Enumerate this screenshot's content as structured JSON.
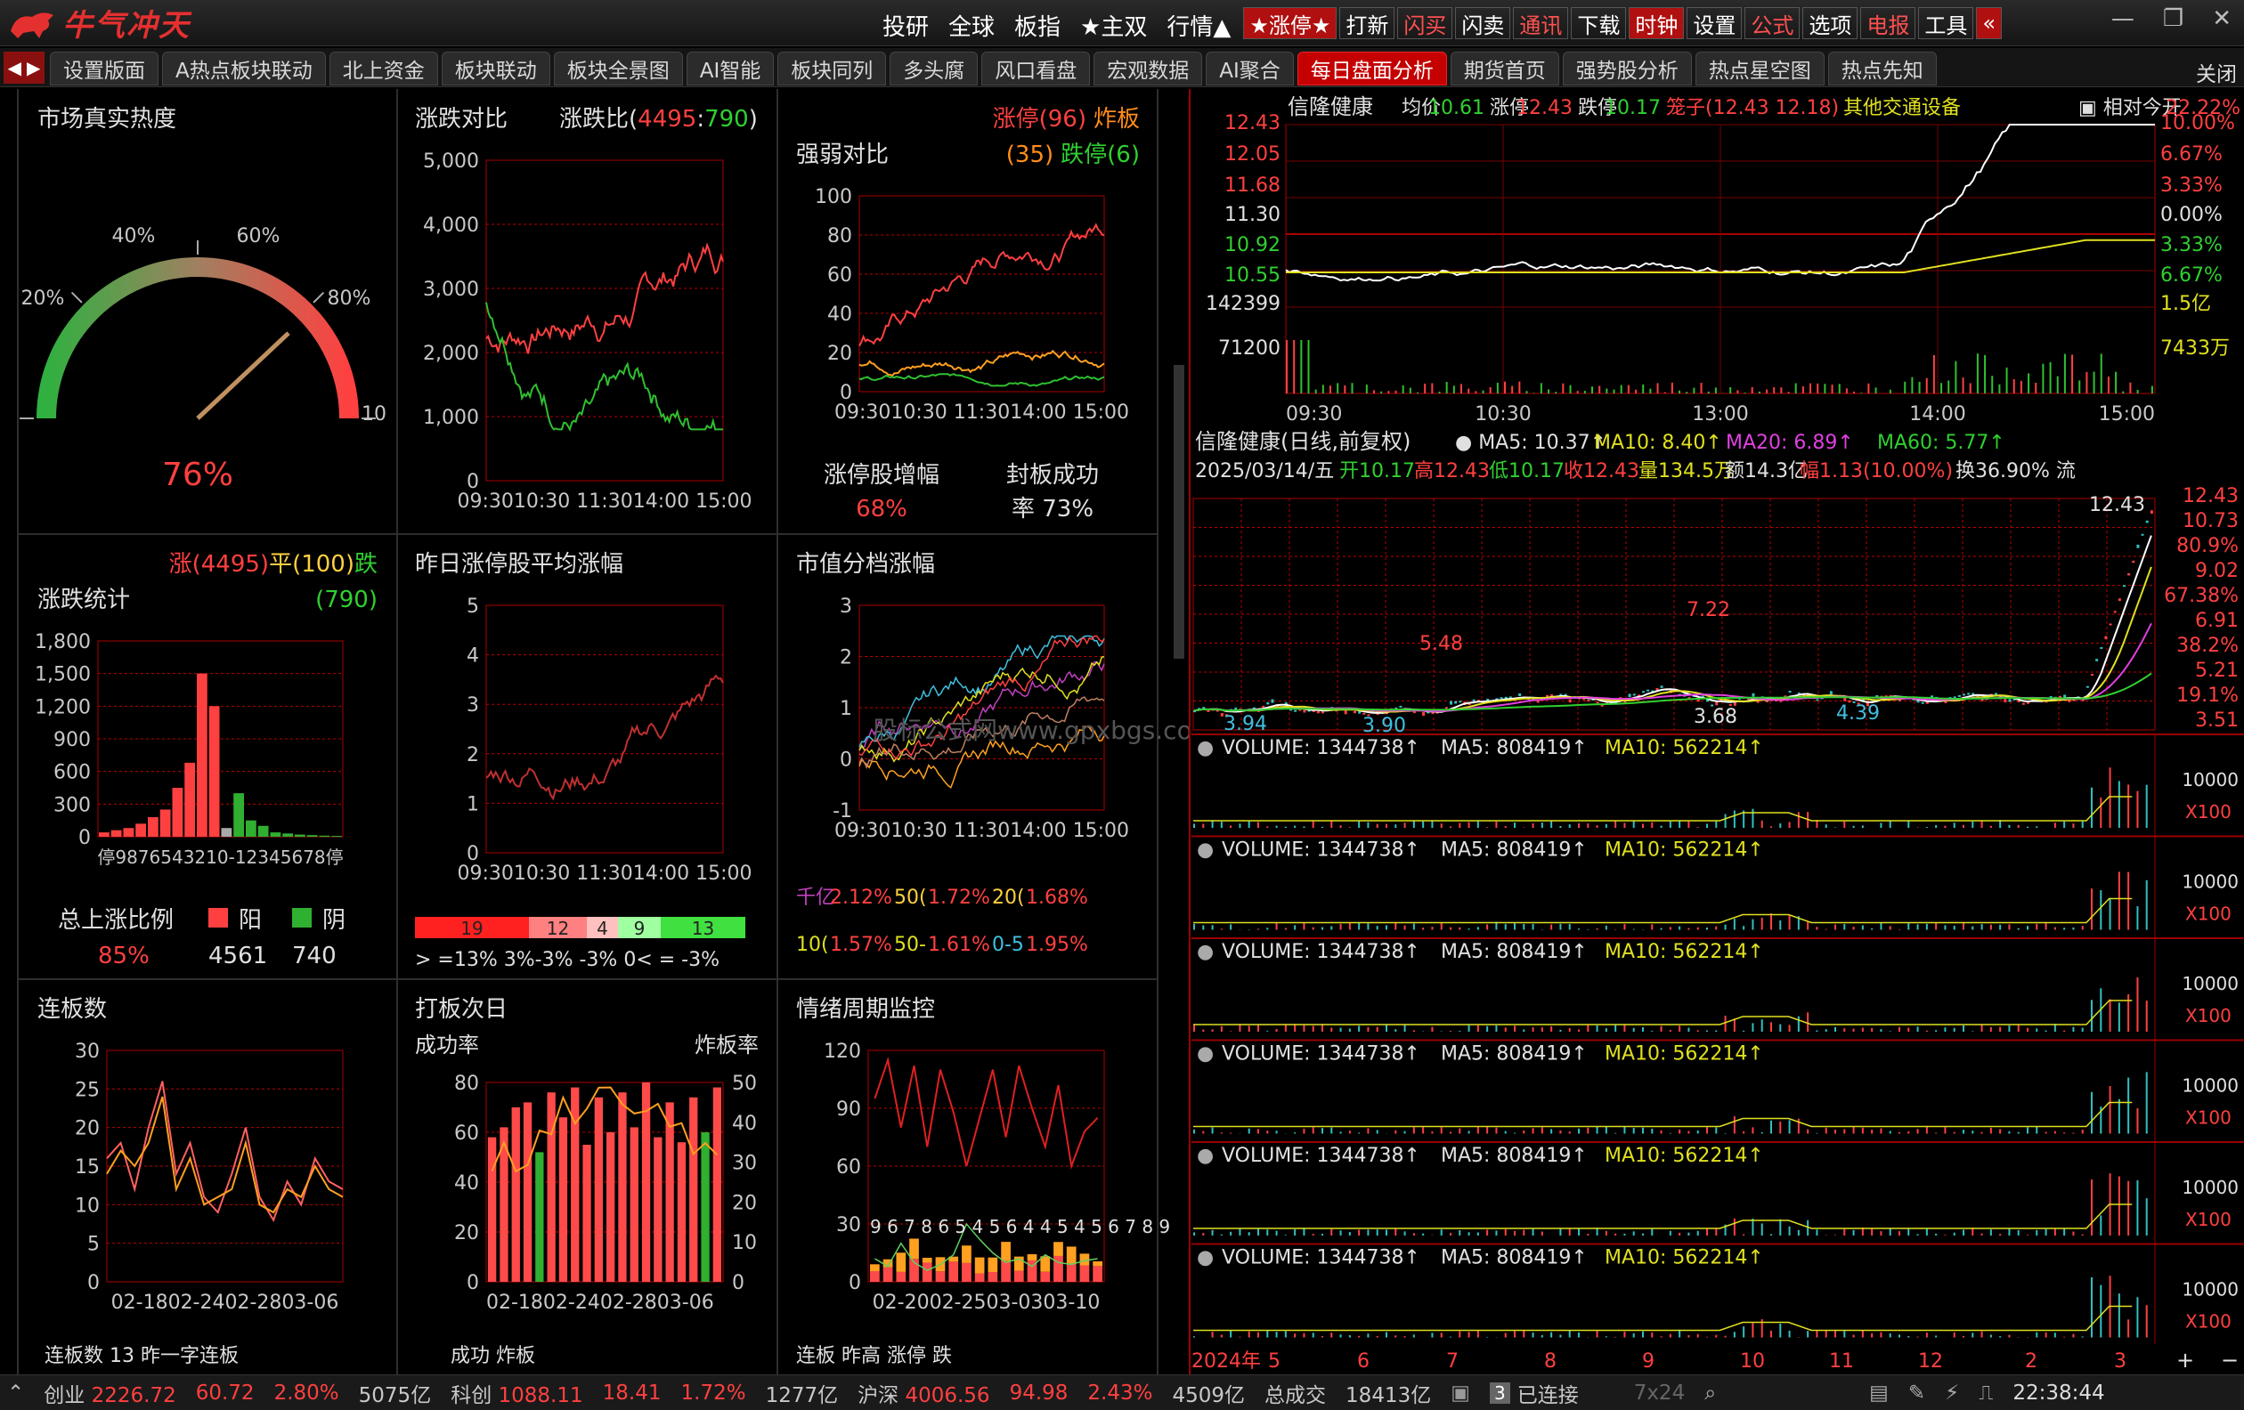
{
  "app": {
    "logo": "牛气冲天"
  },
  "menu": [
    "投研",
    "全球",
    "板指",
    "★主双",
    "行情▲"
  ],
  "toolbar": [
    {
      "label": "★涨停★",
      "style": "redbg"
    },
    {
      "label": "打新"
    },
    {
      "label": "闪买",
      "style": "red"
    },
    {
      "label": "闪卖"
    },
    {
      "label": "通讯",
      "style": "red"
    },
    {
      "label": "下载"
    },
    {
      "label": "时钟",
      "style": "redbg"
    },
    {
      "label": "设置"
    },
    {
      "label": "公式",
      "style": "red"
    },
    {
      "label": "选项"
    },
    {
      "label": "电报",
      "style": "red"
    },
    {
      "label": "工具"
    },
    {
      "label": "«",
      "style": "redbg"
    }
  ],
  "tabs": [
    "设置版面",
    "A热点板块联动",
    "北上资金",
    "板块联动",
    "板块全景图",
    "AI智能",
    "板块同列",
    "多头腐",
    "风口看盘",
    "宏观数据",
    "AI聚合",
    "每日盘面分析",
    "期货首页",
    "强势股分析",
    "热点星空图",
    "热点先知"
  ],
  "active_tab": "每日盘面分析",
  "close_label": "关闭",
  "heat": {
    "title": "市场真实热度",
    "value": "76%",
    "value_num": 76,
    "ticks": [
      "20%",
      "40%",
      "60%",
      "80%",
      "10"
    ]
  },
  "updown": {
    "title": "涨跌对比",
    "ratio_label": "涨跌比(",
    "up": "4495",
    "sep": ":",
    "down": "790",
    "close": ")",
    "y_ticks": [
      "5,000",
      "4,000",
      "3,000",
      "2,000",
      "1,000",
      "0"
    ],
    "x_ticks": "09:3010:30 11:3014:00 15:00"
  },
  "strength": {
    "head1_a": "涨停(96)",
    "head1_b": "炸板",
    "head2_a": "(35)",
    "head2_b": "跌停(6)",
    "title": "强弱对比",
    "y_ticks": [
      "100",
      "80",
      "60",
      "40",
      "20",
      "0"
    ],
    "x_ticks": "09:3010:30 11:3014:00 15:00",
    "lim_label": "涨停股增幅",
    "lim_val": "68%",
    "seal_label": "封板成功",
    "seal_val": "率 73%"
  },
  "stats": {
    "head_up": "涨(4495)",
    "head_flat": "平(100)",
    "head_down": "跌",
    "head_down_n": "(790)",
    "title": "涨跌统计",
    "y_ticks": [
      "1,800",
      "1,500",
      "1,200",
      "900",
      "600",
      "300",
      "0"
    ],
    "x_label": "停9876543210-12345678停",
    "bars": [
      40,
      60,
      80,
      120,
      180,
      250,
      450,
      680,
      1500,
      1200,
      80,
      400,
      150,
      100,
      40,
      30,
      20,
      15,
      10,
      8
    ],
    "ratio_label": "总上涨比例",
    "yang": "阳",
    "yin": "阴",
    "ratio": "85%",
    "yang_n": "4561",
    "yin_n": "740"
  },
  "yday": {
    "title": "昨日涨停股平均涨幅",
    "y_ticks": [
      "5",
      "4",
      "3",
      "2",
      "1",
      "0"
    ],
    "x_ticks": "09:3010:30 11:3014:00 15:00",
    "legend": [
      {
        "v": "19",
        "c": "#ff2020"
      },
      {
        "v": "12",
        "c": "#ff8080"
      },
      {
        "v": "4",
        "c": "#ffc0c0"
      },
      {
        "v": "9",
        "c": "#a0ffa0"
      },
      {
        "v": "13",
        "c": "#40e040"
      }
    ],
    "legend2": "> =13% 3%-3% -3% 0< = -3%"
  },
  "mcap": {
    "title": "市值分档涨幅",
    "y_ticks": [
      "3",
      "2",
      "1",
      "0",
      "-1"
    ],
    "x_ticks": "09:3010:30 11:3014:00 15:00",
    "watermark": "股标公式网www.gpxbgs.com",
    "row1": [
      {
        "t": "千亿",
        "c": "#c040c0"
      },
      {
        "t": "2.12%",
        "c": "#ff4040"
      },
      {
        "t": "50(",
        "c": "#ffd040"
      },
      {
        "t": "1.72%",
        "c": "#ff4040"
      },
      {
        "t": "20(",
        "c": "#ffd040"
      },
      {
        "t": "1.68%",
        "c": "#ff4040"
      }
    ],
    "row2": [
      {
        "t": "10(",
        "c": "#e0e020"
      },
      {
        "t": "1.57%",
        "c": "#ff4040"
      },
      {
        "t": "50-",
        "c": "#e0e020"
      },
      {
        "t": "1.61%",
        "c": "#ff4040"
      },
      {
        "t": "0-5",
        "c": "#40c0e0"
      },
      {
        "t": "1.95%",
        "c": "#ff4040"
      }
    ]
  },
  "lianban": {
    "title": "连板数",
    "y_ticks": [
      "30",
      "25",
      "20",
      "15",
      "10",
      "5",
      "0"
    ],
    "x_ticks": "02-1802-2402-2803-06",
    "legend": "连板数 13   昨一字连板"
  },
  "daban": {
    "title": "打板次日",
    "sub_l": "成功率",
    "sub_r": "炸板率",
    "yl": [
      "80",
      "60",
      "40",
      "20",
      "0"
    ],
    "yr": [
      "50",
      "40",
      "30",
      "20",
      "10",
      "0"
    ],
    "x_ticks": "02-1802-2402-2803-06",
    "legend": "成功 炸板"
  },
  "emotion": {
    "title": "情绪周期监控",
    "y_ticks": [
      "120",
      "90",
      "60",
      "30",
      "0"
    ],
    "x_ticks": "02-2002-2503-0303-10",
    "nums": "9 6 7 8 6 5 4 5 6 4 4 5 4 5 6 7 8 9",
    "legend": "连板 昨高 涨停 跌"
  },
  "intraday": {
    "name": "信隆健康",
    "avg_l": "均价",
    "avg": "10.61",
    "zt_l": "涨停",
    "zt": "12.43",
    "dt_l": "跌停",
    "dt": "10.17",
    "cage": "笼子(12.43 12.18)",
    "sector": "其他交通设备",
    "rel": "相对今开",
    "rel_v": "22.22%",
    "yl": [
      "12.43",
      "12.05",
      "11.68",
      "11.30",
      "10.92",
      "10.55",
      "142399",
      "71200"
    ],
    "yr": [
      "10.00%",
      "6.67%",
      "3.33%",
      "0.00%",
      "3.33%",
      "6.67%",
      "1.5亿",
      "7433万"
    ],
    "x_ticks": [
      "09:30",
      "10:30",
      "13:00",
      "14:00",
      "15:00"
    ]
  },
  "daily": {
    "name": "信隆健康(日线,前复权)",
    "ma5": "MA5: 10.37",
    "ma10": "MA10: 8.40",
    "ma20": "MA20: 6.89",
    "ma60": "MA60: 5.77",
    "info_date": "2025/03/14/五",
    "open": "开10.17",
    "high": "高12.43",
    "low": "低10.17",
    "close": "收12.43",
    "vol": "量134.5万",
    "amt": "额14.3亿",
    "amp": "幅1.13(10.00%)",
    "turn": "换36.90% 流",
    "marks": [
      "12.43",
      "5.48",
      "7.22",
      "3.94",
      "3.90",
      "3.68",
      "4.39"
    ],
    "yr": [
      "12.43",
      "10.73",
      "80.9%",
      "9.02",
      "67.38%",
      "6.91",
      "38.2%",
      "5.21",
      "19.1%",
      "3.51"
    ]
  },
  "vol": {
    "label": "VOLUME: 1344738",
    "ma5": "MA5: 808419",
    "ma10": "MA10: 562214",
    "r1": "10000",
    "r2": "X100"
  },
  "timeline": [
    "2024年",
    "5",
    "6",
    "7",
    "8",
    "9",
    "10",
    "11",
    "12",
    "2",
    "3"
  ],
  "status": {
    "cy_l": "创业",
    "cy": "2226.72",
    "cy_c": "60.72",
    "cy_p": "2.80%",
    "cy_v": "5075亿",
    "kc_l": "科创",
    "kc": "1088.11",
    "kc_c": "18.41",
    "kc_p": "1.72%",
    "kc_v": "1277亿",
    "hs_l": "沪深",
    "hs": "4006.56",
    "hs_c": "94.98",
    "hs_p": "2.43%",
    "hs_v": "4509亿",
    "tot_l": "总成交",
    "tot": "18413亿",
    "conn": "已连接",
    "mode": "7x24",
    "time": "22:38:44",
    "badge": "3"
  }
}
